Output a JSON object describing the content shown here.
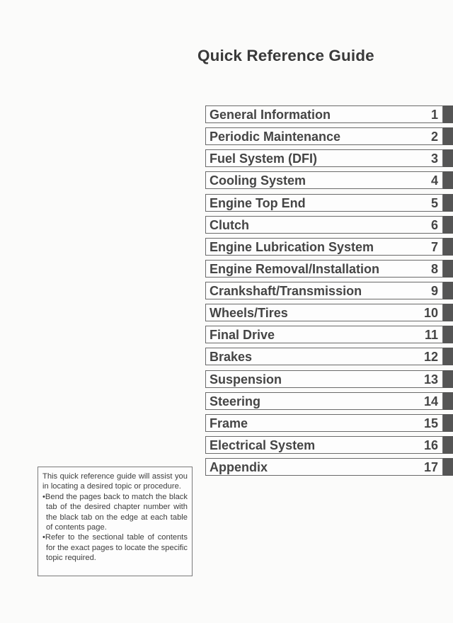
{
  "page": {
    "title": "Quick Reference Guide"
  },
  "toc": {
    "items": [
      {
        "label": "General Information",
        "number": "1"
      },
      {
        "label": "Periodic Maintenance",
        "number": "2"
      },
      {
        "label": "Fuel System (DFI)",
        "number": "3"
      },
      {
        "label": "Cooling System",
        "number": "4"
      },
      {
        "label": "Engine Top End",
        "number": "5"
      },
      {
        "label": "Clutch",
        "number": "6"
      },
      {
        "label": "Engine Lubrication System",
        "number": "7"
      },
      {
        "label": "Engine Removal/Installation",
        "number": "8"
      },
      {
        "label": "Crankshaft/Transmission",
        "number": "9"
      },
      {
        "label": "Wheels/Tires",
        "number": "10"
      },
      {
        "label": "Final Drive",
        "number": "11"
      },
      {
        "label": "Brakes",
        "number": "12"
      },
      {
        "label": "Suspension",
        "number": "13"
      },
      {
        "label": "Steering",
        "number": "14"
      },
      {
        "label": "Frame",
        "number": "15"
      },
      {
        "label": "Electrical System",
        "number": "16"
      },
      {
        "label": "Appendix",
        "number": "17"
      }
    ]
  },
  "note": {
    "intro": "This quick reference guide will assist you in locating a desired topic or procedure.",
    "bullets": [
      "•Bend the pages back to match the black tab of the desired chapter number with the black tab on the edge at each table of contents page.",
      "•Refer to the sectional table of contents for the exact pages to locate the specific topic required."
    ]
  },
  "colors": {
    "tab": "#555555",
    "text": "#454545"
  }
}
